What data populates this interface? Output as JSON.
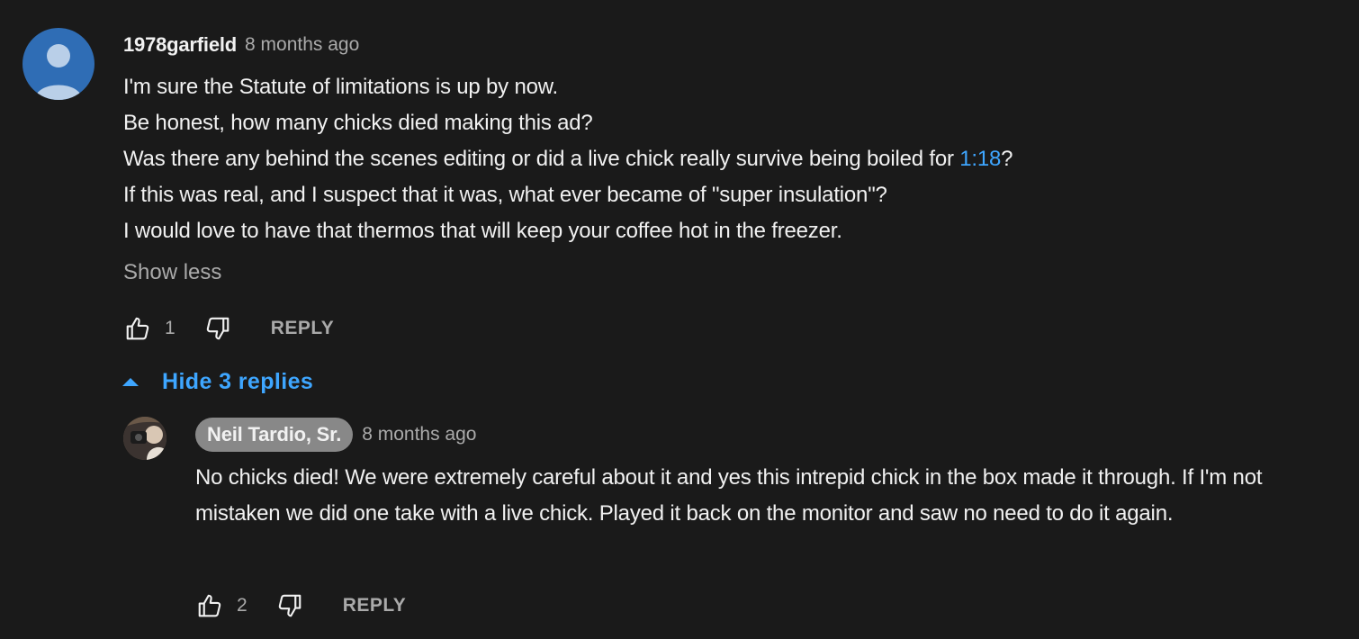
{
  "comment": {
    "author": "1978garfield",
    "time": "8 months ago",
    "avatar_color": "#2f6db5",
    "lines": [
      "I'm sure the Statute of limitations is up by now.",
      "Be honest, how many chicks died making this ad?",
      "Was there any behind the scenes editing or did a live chick really survive being boiled for ",
      "If this was real, and I suspect that it was, what ever became of \"super insulation\"?",
      "I would love to have that thermos that will keep your coffee hot in the freezer."
    ],
    "timestamp_link": "1:18",
    "after_link": "?",
    "show_less": "Show less",
    "like_count": "1",
    "reply_label": "REPLY",
    "like_icon": "thumbs-up-icon",
    "dislike_icon": "thumbs-down-icon"
  },
  "replies_toggle": {
    "label": "Hide 3 replies",
    "icon": "caret-up-icon",
    "color": "#3ea6ff"
  },
  "reply": {
    "author": "Neil Tardio, Sr.",
    "time": "8 months ago",
    "text": "No chicks died! We were extremely careful about it and yes this intrepid chick in the box made it through. If I'm not mistaken we did one take with a live chick. Played it back on the monitor and saw no need to do it again.",
    "like_count": "2",
    "reply_label": "REPLY"
  }
}
